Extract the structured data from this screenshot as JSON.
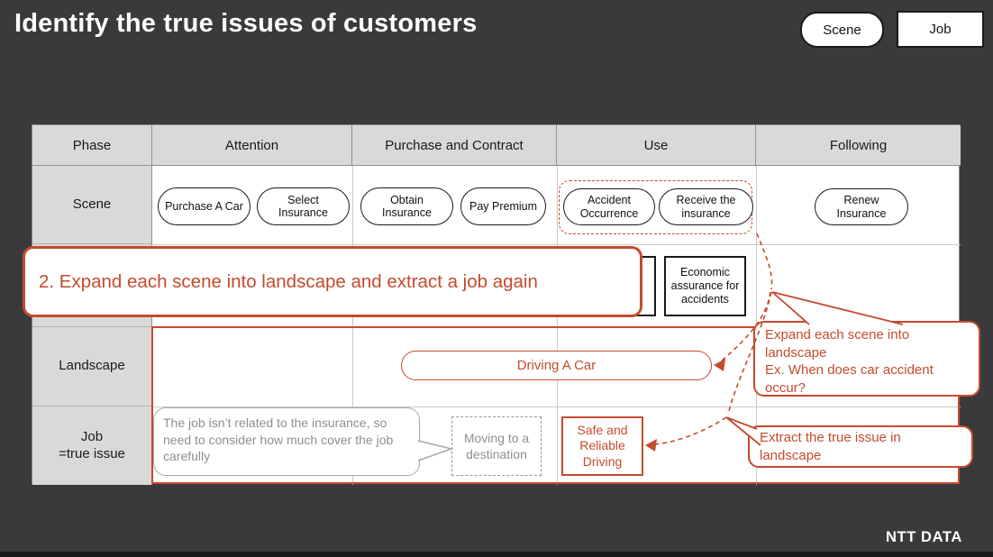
{
  "title": "Identify the true issues of customers",
  "legend": {
    "scene": "Scene",
    "job": "Job"
  },
  "table": {
    "headers": {
      "phase": "Phase",
      "attention": "Attention",
      "purchase_contract": "Purchase and Contract",
      "use": "Use",
      "following": "Following"
    },
    "row_labels": {
      "scene": "Scene",
      "landscape": "Landscape",
      "job": "Job\n=true issue"
    },
    "scene_pills": {
      "purchase_a_car": "Purchase A Car",
      "select_insurance": "Select Insurance",
      "obtain_insurance": "Obtain Insurance",
      "pay_premium": "Pay Premium",
      "accident_occurrence": "Accident Occurrence",
      "receive_the_insurance": "Receive the insurance",
      "renew_insurance": "Renew Insurance"
    },
    "job_boxes": {
      "economic_assurance": "Economic assurance for accidents"
    },
    "landscape_items": {
      "driving_a_car": "Driving A Car"
    },
    "job_items": {
      "note": "The job isn’t related to the insurance, so need to consider how much cover the job carefully",
      "moving": "Moving to a destination",
      "safe_driving": "Safe and Reliable Driving"
    }
  },
  "banner": "2. Expand each scene into landscape and extract a job again",
  "callouts": {
    "expand": "Expand each scene into landscape\nEx. When does car accident occur?",
    "extract": "Extract the true issue in landscape"
  },
  "footer": {
    "brand": "NTT DATA"
  },
  "colors": {
    "accent_red": "#c54b2d",
    "background_dark": "#3a3a3c",
    "cell_gray": "#d9d9d9",
    "muted_gray": "#8f8f8f"
  }
}
